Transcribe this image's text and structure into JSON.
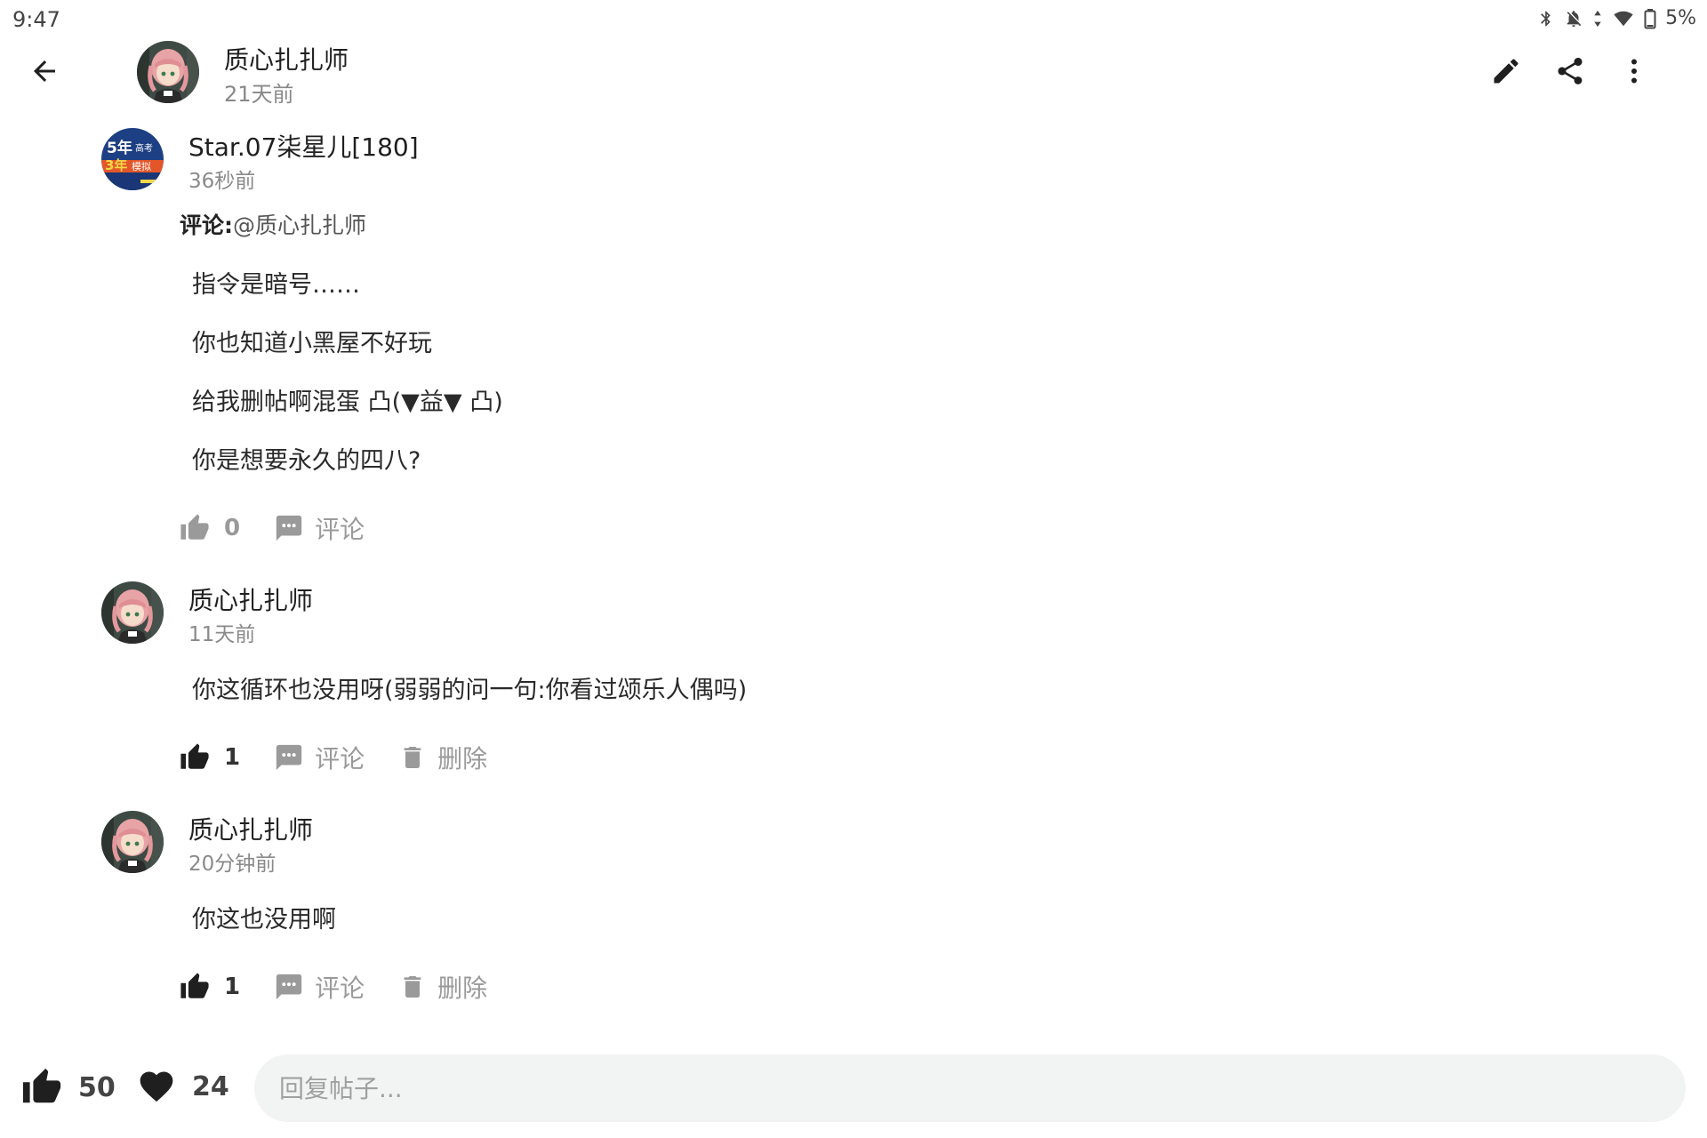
{
  "status_bar": {
    "time": "9:47",
    "battery": "5%",
    "icons": [
      "bluetooth-icon",
      "bell-off-icon",
      "data-arrows-icon",
      "wifi-icon",
      "battery-icon"
    ]
  },
  "header": {
    "author": "质心扎扎师",
    "time": "21天前",
    "actions": [
      "edit-icon",
      "share-icon",
      "more-vert-icon"
    ]
  },
  "comments": [
    {
      "author": "Star.07柒星儿[180]",
      "time": "36秒前",
      "reply_label": "评论:",
      "reply_target": "@质心扎扎师",
      "lines": [
        "指令是暗号……",
        "你也知道小黑屋不好玩",
        "给我删帖啊混蛋 凸(▼益▼ 凸)",
        "你是想要永久的四八?"
      ],
      "likes": "0",
      "comment_label": "评论"
    },
    {
      "author": "质心扎扎师",
      "time": "11天前",
      "lines": [
        "你这循环也没用呀(弱弱的问一句:你看过颂乐人偶吗)"
      ],
      "likes": "1",
      "comment_label": "评论",
      "delete_label": "删除"
    },
    {
      "author": "质心扎扎师",
      "time": "20分钟前",
      "lines": [
        "你这也没用啊"
      ],
      "likes": "1",
      "comment_label": "评论",
      "delete_label": "删除"
    }
  ],
  "bottom": {
    "likes": "50",
    "hearts": "24",
    "reply_placeholder": "回复帖子..."
  },
  "colors": {
    "icon_gray": "#9a9a9a",
    "icon_dark": "#1f1f1f",
    "reply_bg": "#f2f3f3"
  }
}
